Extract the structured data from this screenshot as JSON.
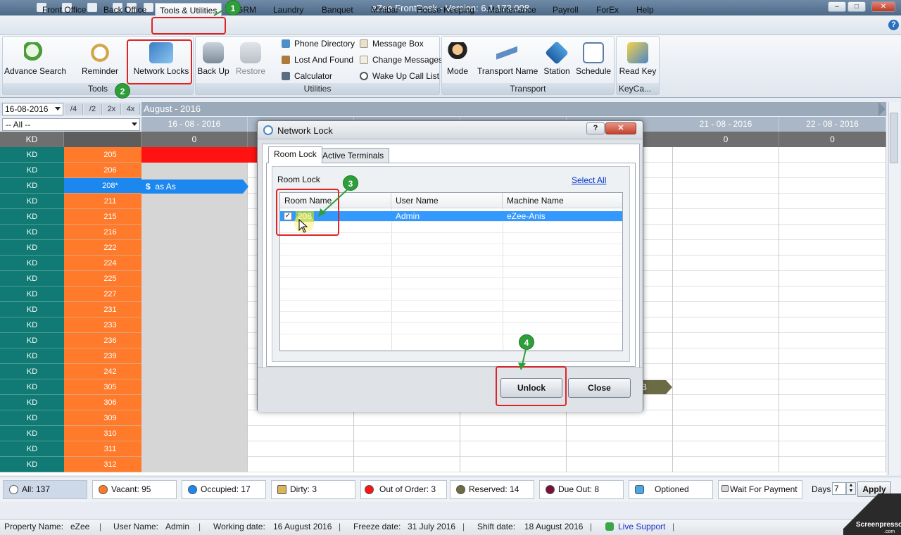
{
  "window": {
    "title": "eZee FrontDesk - Version: 6.1.173.008",
    "min": "–",
    "max": "□",
    "close": "✕"
  },
  "menu": [
    "Front Office",
    "Back Office",
    "Tools & Utilities",
    "GRM",
    "Laundry",
    "Banquet",
    "Minibar",
    "House Keeping",
    "Maintenance",
    "Payroll",
    "ForEx",
    "Help"
  ],
  "ribbon": {
    "tools": {
      "label": "Tools",
      "buttons": [
        "Advance Search",
        "Reminder",
        "Network Locks"
      ]
    },
    "utilities": {
      "label": "Utilities",
      "buttons": [
        "Back Up",
        "Restore"
      ],
      "small_left": [
        "Phone Directory",
        "Lost And Found",
        "Calculator"
      ],
      "small_right": [
        "Message Box",
        "Change Messages",
        "Wake Up Call List"
      ]
    },
    "transport": {
      "label": "Transport",
      "buttons": [
        "Mode",
        "Transport Name",
        "Station",
        "Schedule"
      ]
    },
    "keycard": {
      "label": "KeyCa...",
      "buttons": [
        "Read Key"
      ]
    }
  },
  "annotations": [
    "1",
    "2",
    "3",
    "4"
  ],
  "grid": {
    "date_value": "16-08-2016",
    "zoom": [
      "/4",
      "/2",
      "2x",
      "4x"
    ],
    "month": "August - 2016",
    "filter": "-- All --",
    "dates": [
      "16 - 08 - 2016",
      "",
      "",
      "",
      "21 - 08 - 2016",
      "22 - 08 - 2016"
    ],
    "counts": [
      "KD",
      "0",
      "",
      "",
      "",
      "0",
      "0"
    ],
    "rooms": [
      {
        "type": "KD",
        "num": "205"
      },
      {
        "type": "KD",
        "num": "206"
      },
      {
        "type": "KD",
        "num": "208*"
      },
      {
        "type": "KD",
        "num": "211"
      },
      {
        "type": "KD",
        "num": "215"
      },
      {
        "type": "KD",
        "num": "216"
      },
      {
        "type": "KD",
        "num": "222"
      },
      {
        "type": "KD",
        "num": "224"
      },
      {
        "type": "KD",
        "num": "225"
      },
      {
        "type": "KD",
        "num": "227"
      },
      {
        "type": "KD",
        "num": "231"
      },
      {
        "type": "KD",
        "num": "233"
      },
      {
        "type": "KD",
        "num": "236"
      },
      {
        "type": "KD",
        "num": "239"
      },
      {
        "type": "KD",
        "num": "242"
      },
      {
        "type": "KD",
        "num": "305"
      },
      {
        "type": "KD",
        "num": "306"
      },
      {
        "type": "KD",
        "num": "309"
      },
      {
        "type": "KD",
        "num": "310"
      },
      {
        "type": "KD",
        "num": "311"
      },
      {
        "type": "KD",
        "num": "312"
      }
    ],
    "booking_label": "as As",
    "booking_currency": "$",
    "reserved_mark": "B"
  },
  "legend": {
    "all": "All: 137",
    "vacant": "Vacant: 95",
    "occupied": "Occupied: 17",
    "dirty": "Dirty: 3",
    "out_of_order": "Out of Order: 3",
    "reserved": "Reserved: 14",
    "due_out": "Due Out: 8",
    "optioned": "Optioned",
    "wait_payment": "Wait For Payment",
    "days_label": "Days",
    "days_value": "7",
    "apply": "Apply",
    "colors": {
      "vacant": "#ff7a2a",
      "occupied": "#1c87ee",
      "out_of_order": "#ff1212",
      "reserved": "#6b6b45",
      "due_out": "#7a0f3a"
    }
  },
  "status": {
    "property_label": "Property Name:",
    "property": "eZee",
    "user_label": "User Name:",
    "user": "Admin",
    "working_label": "Working date:",
    "working": "16 August 2016",
    "freeze_label": "Freeze date:",
    "freeze": "31 July 2016",
    "shift_label": "Shift date:",
    "shift": "18 August 2016",
    "live_support": "Live Support"
  },
  "dialog": {
    "title": "Network Lock",
    "help": "?",
    "close": "✕",
    "tabs": [
      "Room Lock",
      "Active Terminals"
    ],
    "group_title": "Room Lock",
    "select_all": "Select All",
    "columns": [
      "Room Name",
      "User Name",
      "Machine Name"
    ],
    "rows": [
      {
        "room": "208",
        "user": "Admin",
        "machine": "eZee-Anis",
        "checked": true
      }
    ],
    "unlock": "Unlock",
    "close_btn": "Close"
  },
  "watermark": {
    "name": "Screenpresso",
    "sub": ".com"
  }
}
